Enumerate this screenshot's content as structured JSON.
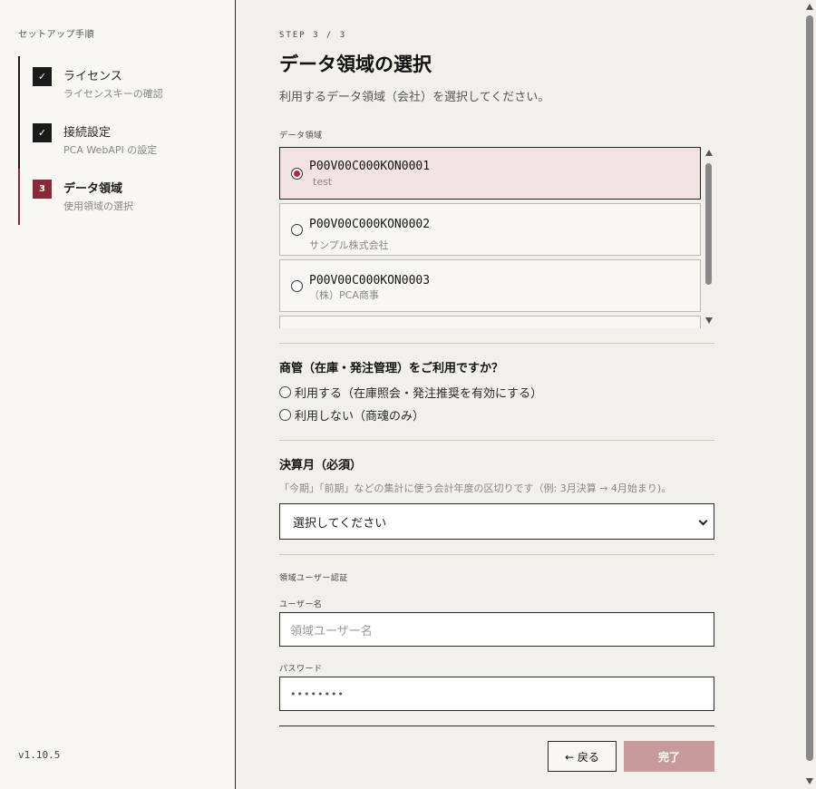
{
  "sidebar": {
    "heading": "セットアップ手順",
    "steps": [
      {
        "marker": "✓",
        "title": "ライセンス",
        "subtitle": "ライセンスキーの確認",
        "status": "done"
      },
      {
        "marker": "✓",
        "title": "接続設定",
        "subtitle": "PCA WebAPI の設定",
        "status": "done"
      },
      {
        "marker": "3",
        "title": "データ領域",
        "subtitle": "使用領域の選択",
        "status": "active"
      }
    ],
    "version": "v1.10.5"
  },
  "main": {
    "step_indicator": "STEP 3 / 3",
    "title": "データ領域の選択",
    "description": "利用するデータ領域（会社）を選択してください。",
    "data_area": {
      "label": "データ領域",
      "items": [
        {
          "code": "P00V00C000KON0001",
          "name": "test",
          "selected": true
        },
        {
          "code": "P00V00C000KON0002",
          "name": "サンプル株式会社",
          "selected": false
        },
        {
          "code": "P00V00C000KON0003",
          "name": "（株）PCA商事",
          "selected": false
        }
      ]
    },
    "inventory": {
      "question": "商管（在庫・発注管理）をご利用ですか？",
      "options": [
        "利用する（在庫照会・発注推奨を有効にする）",
        "利用しない（商魂のみ）"
      ]
    },
    "fiscal": {
      "title": "決算月（必須）",
      "help": "「今期」「前期」などの集計に使う会計年度の区切りです（例: 3月決算 → 4月始まり)。",
      "select_value": "選択してください"
    },
    "auth": {
      "section_label": "領域ユーザー認証",
      "username_label": "ユーザー名",
      "username_placeholder": "領域ユーザー名",
      "password_label": "パスワード",
      "password_value": "••••••••"
    },
    "buttons": {
      "back": "← 戻る",
      "done": "完了"
    }
  },
  "colors": {
    "accent": "#8a2a38",
    "selected_bg": "#f3e2e2",
    "disabled_button": "#c99a9b"
  }
}
